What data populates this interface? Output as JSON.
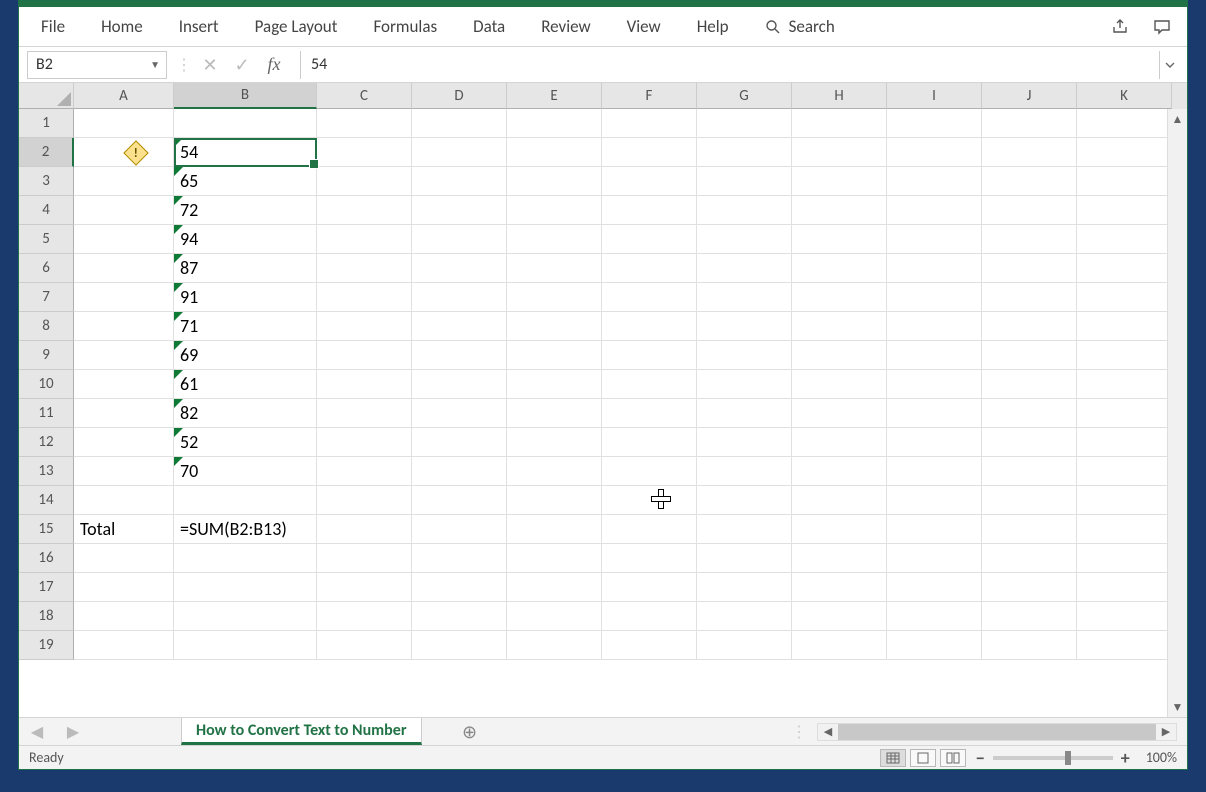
{
  "ribbon": {
    "tabs": [
      "File",
      "Home",
      "Insert",
      "Page Layout",
      "Formulas",
      "Data",
      "Review",
      "View",
      "Help"
    ],
    "search_label": "Search"
  },
  "formula_bar": {
    "name_box": "B2",
    "fx_label": "fx",
    "value": "54"
  },
  "columns": [
    "A",
    "B",
    "C",
    "D",
    "E",
    "F",
    "G",
    "H",
    "I",
    "J",
    "K"
  ],
  "selected_col": "B",
  "selected_row": 2,
  "selected_cell": "B2",
  "rows": [
    {
      "n": 1,
      "a": "",
      "b": ""
    },
    {
      "n": 2,
      "a": "",
      "b": "54",
      "err": true
    },
    {
      "n": 3,
      "a": "",
      "b": "65",
      "err": true
    },
    {
      "n": 4,
      "a": "",
      "b": "72",
      "err": true
    },
    {
      "n": 5,
      "a": "",
      "b": "94",
      "err": true
    },
    {
      "n": 6,
      "a": "",
      "b": "87",
      "err": true
    },
    {
      "n": 7,
      "a": "",
      "b": "91",
      "err": true
    },
    {
      "n": 8,
      "a": "",
      "b": "71",
      "err": true
    },
    {
      "n": 9,
      "a": "",
      "b": "69",
      "err": true
    },
    {
      "n": 10,
      "a": "",
      "b": "61",
      "err": true
    },
    {
      "n": 11,
      "a": "",
      "b": "82",
      "err": true
    },
    {
      "n": 12,
      "a": "",
      "b": "52",
      "err": true
    },
    {
      "n": 13,
      "a": "",
      "b": "70",
      "err": true
    },
    {
      "n": 14,
      "a": "",
      "b": ""
    },
    {
      "n": 15,
      "a": "Total",
      "b": "=SUM(B2:B13)"
    },
    {
      "n": 16,
      "a": "",
      "b": ""
    },
    {
      "n": 17,
      "a": "",
      "b": ""
    },
    {
      "n": 18,
      "a": "",
      "b": ""
    },
    {
      "n": 19,
      "a": "",
      "b": ""
    }
  ],
  "sheet_tab": "How to Convert Text to Number",
  "status": {
    "ready": "Ready",
    "zoom": "100%"
  }
}
